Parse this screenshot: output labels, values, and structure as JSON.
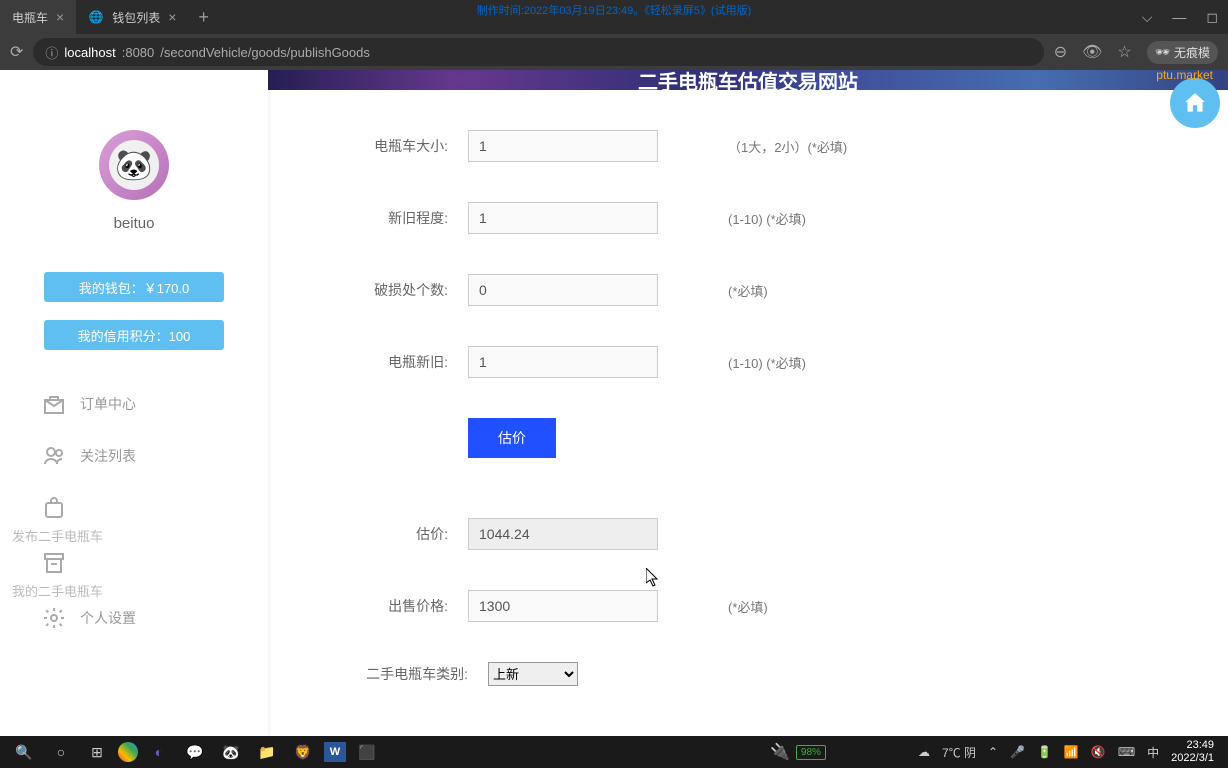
{
  "watermark": "制作时间:2022年03月19日23:49。《轻松录屏5》(试用版)",
  "browser": {
    "tabs": [
      {
        "title": "电瓶车",
        "active": true
      },
      {
        "title": "钱包列表",
        "active": false
      }
    ],
    "url_prefix": "localhost",
    "url_port": ":8080",
    "url_path": "/secondVehicle/goods/publishGoods",
    "profile_label": "无痕模"
  },
  "banner": {
    "title": "二手电瓶车估值交易网站",
    "tag": "ptu.market"
  },
  "sidebar": {
    "username": "beituo",
    "wallet": "我的钱包：￥170.0",
    "credit": "我的信用积分：100",
    "menu": {
      "orders": "订单中心",
      "follow": "关注列表",
      "publish": "发布二手电瓶车",
      "mine": "我的二手电瓶车",
      "settings": "个人设置"
    }
  },
  "form": {
    "size_label": "电瓶车大小:",
    "size_value": "1",
    "size_hint": "（1大，2小）(*必填)",
    "cond_label": "新旧程度:",
    "cond_value": "1",
    "cond_hint": "(1-10) (*必填)",
    "damage_label": "破损处个数:",
    "damage_value": "0",
    "damage_hint": "(*必填)",
    "battery_label": "电瓶新旧:",
    "battery_value": "1",
    "battery_hint": "(1-10) (*必填)",
    "eval_btn": "估价",
    "eval_label": "估价:",
    "eval_value": "1044.24",
    "price_label": "出售价格:",
    "price_value": "1300",
    "price_hint": "(*必填)",
    "category_label": "二手电瓶车类别:",
    "category_value": "上新"
  },
  "taskbar": {
    "weather": "7℃ 阴",
    "battery": "98%",
    "ime": "中",
    "time": "23:49",
    "date": "2022/3/1"
  }
}
